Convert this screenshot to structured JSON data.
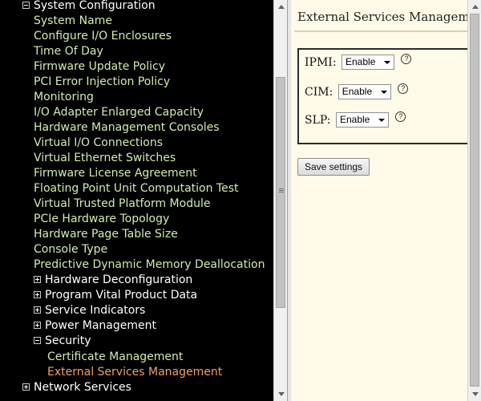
{
  "nav": {
    "system_configuration": {
      "label": "System Configuration",
      "items": [
        "System Name",
        "Configure I/O Enclosures",
        "Time Of Day",
        "Firmware Update Policy",
        "PCI Error Injection Policy",
        "Monitoring",
        "I/O Adapter Enlarged Capacity",
        "Hardware Management Consoles",
        "Virtual I/O Connections",
        "Virtual Ethernet Switches",
        "Firmware License Agreement",
        "Floating Point Unit Computation Test",
        "Virtual Trusted Platform Module",
        "PCIe Hardware Topology",
        "Hardware Page Table Size",
        "Console Type",
        "Predictive Dynamic Memory Deallocation"
      ],
      "subcategories": [
        "Hardware Deconfiguration",
        "Program Vital Product Data",
        "Service Indicators",
        "Power Management"
      ],
      "security": {
        "label": "Security",
        "items": [
          "Certificate Management",
          "External Services Management"
        ]
      }
    },
    "network_services": {
      "label": "Network Services"
    }
  },
  "content": {
    "title": "External Services Management",
    "fields": [
      {
        "label": "IPMI:",
        "value": "Enable",
        "help": "?"
      },
      {
        "label": "CIM:",
        "value": "Enable",
        "help": "?"
      },
      {
        "label": "SLP:",
        "value": "Enable",
        "help": "?"
      }
    ],
    "save_label": "Save settings"
  },
  "colors": {
    "nav_background": "#000000",
    "nav_item": "#d0ecb0",
    "nav_category": "#ffffff",
    "nav_selected": "#f0a060",
    "content_background": "#fffbe8"
  }
}
